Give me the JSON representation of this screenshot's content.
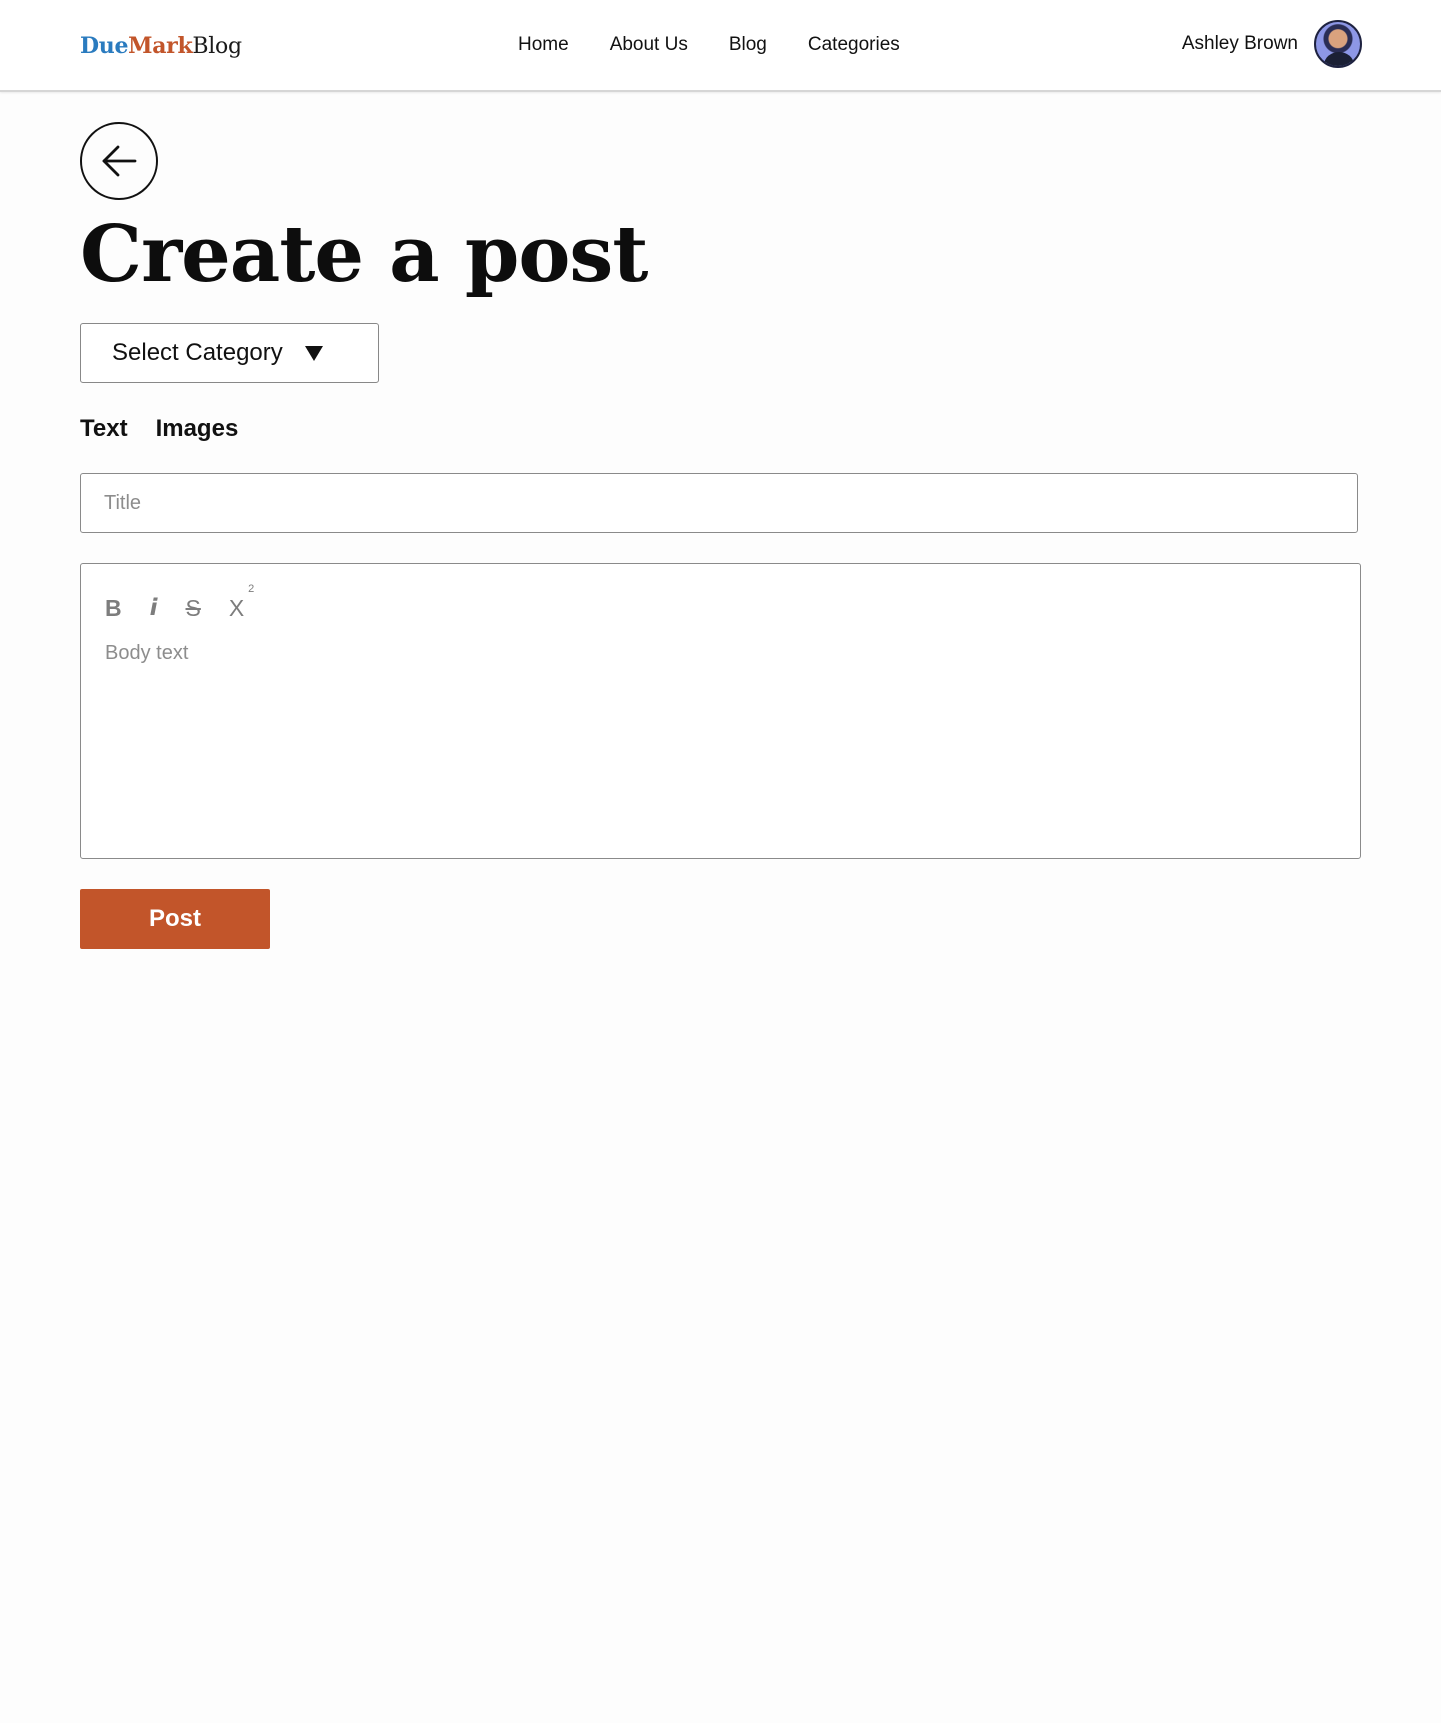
{
  "header": {
    "logo": {
      "part1": "Due",
      "part2": "Mark",
      "part3": "Blog"
    },
    "nav": [
      "Home",
      "About Us",
      "Blog",
      "Categories"
    ],
    "user": {
      "name": "Ashley Brown"
    }
  },
  "main": {
    "back_icon": "arrow-left-icon",
    "title": "Create a post",
    "category_select": {
      "selected": "Select Category"
    },
    "tabs": [
      {
        "label": "Text",
        "active": true
      },
      {
        "label": "Images",
        "active": false
      }
    ],
    "title_input": {
      "placeholder": "Title",
      "value": ""
    },
    "editor": {
      "toolbar": {
        "bold": "B",
        "italic": "i",
        "strikethrough": "S",
        "superscript_base": "X",
        "superscript_exp": "2"
      },
      "placeholder": "Body text",
      "value": ""
    },
    "post_button": "Post"
  },
  "colors": {
    "accent": "#c2552a",
    "logo_due": "#2a7bbf",
    "logo_mark": "#c2552a"
  }
}
